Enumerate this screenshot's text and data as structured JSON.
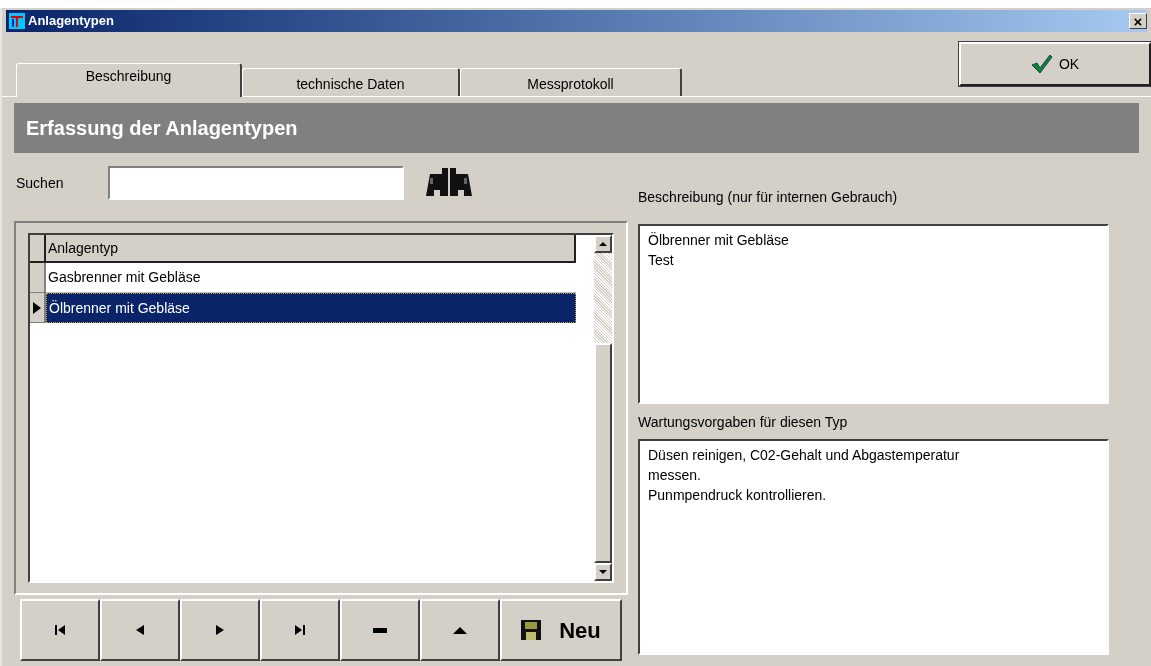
{
  "window": {
    "title": "Anlagentypen",
    "close": "×"
  },
  "tabs": [
    {
      "label": "Beschreibung",
      "selected": true
    },
    {
      "label": "technische Daten",
      "selected": false
    },
    {
      "label": "Messprotokoll",
      "selected": false
    }
  ],
  "ok_button": "OK",
  "header": "Erfassung der Anlagentypen",
  "search": {
    "label": "Suchen"
  },
  "grid": {
    "columns": [
      "Anlagentyp"
    ],
    "rows": [
      {
        "cells": [
          "Gasbrenner mit Gebläse"
        ],
        "selected": false
      },
      {
        "cells": [
          "Ölbrenner mit Gebläse"
        ],
        "selected": true
      }
    ]
  },
  "nav_buttons": [
    {
      "kind": "first"
    },
    {
      "kind": "prior"
    },
    {
      "kind": "next"
    },
    {
      "kind": "last"
    },
    {
      "kind": "delete"
    },
    {
      "kind": "post"
    },
    {
      "kind": "new",
      "label": "Neu"
    }
  ],
  "description": {
    "label": "Beschreibung (nur für internen Gebrauch)",
    "lines": [
      "Ölbrenner mit Gebläse",
      "Test"
    ]
  },
  "maintenance": {
    "label": "Wartungsvorgaben für diesen Typ",
    "lines": [
      "Düsen reinigen, C02-Gehalt und Abgastemperatur",
      "messen.",
      "Punmpendruck kontrollieren."
    ]
  }
}
